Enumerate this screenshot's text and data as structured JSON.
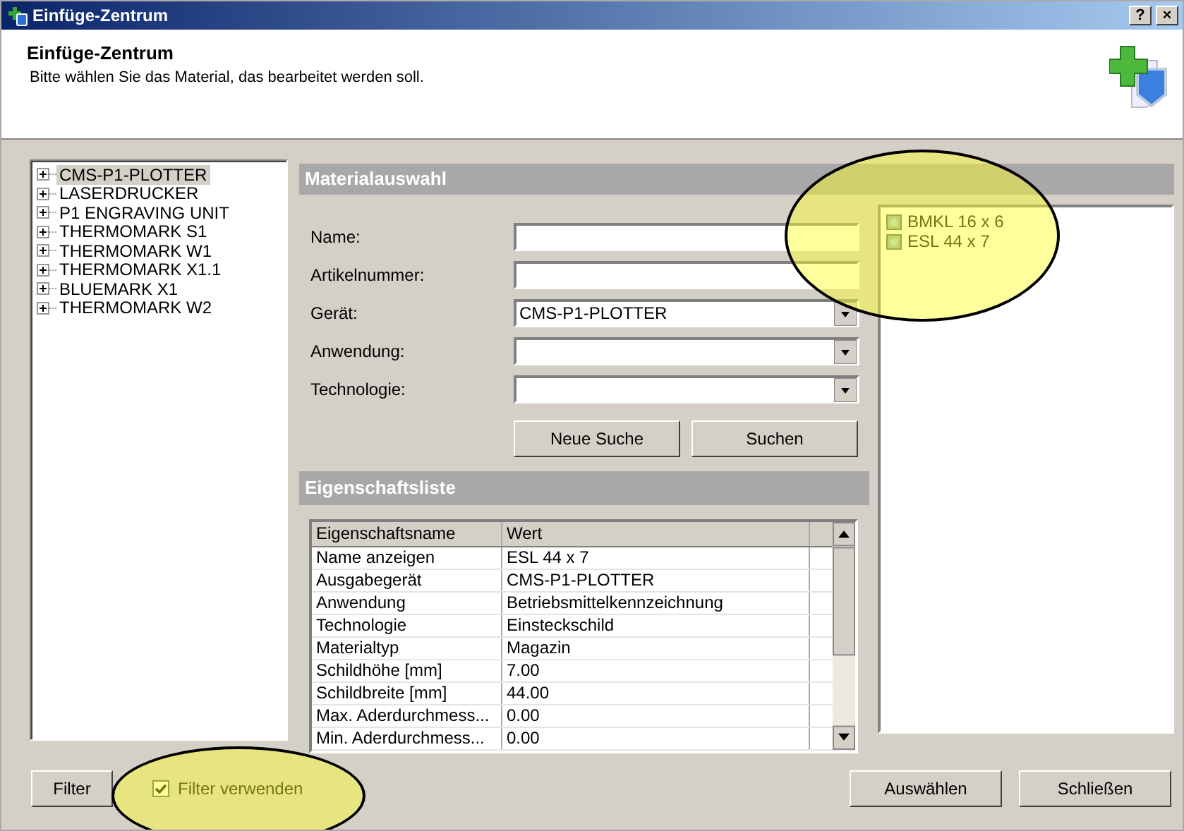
{
  "window": {
    "title": "Einfüge-Zentrum",
    "controls": [
      "?",
      "×"
    ]
  },
  "header": {
    "title": "Einfüge-Zentrum",
    "subtitle": "Bitte wählen Sie das Material, das bearbeitet werden soll."
  },
  "device_tree": [
    {
      "label": "CMS-P1-PLOTTER",
      "expanded": false,
      "selected": true
    },
    {
      "label": "LASERDRUCKER",
      "expanded": false,
      "selected": false
    },
    {
      "label": "P1 ENGRAVING UNIT",
      "expanded": false,
      "selected": false
    },
    {
      "label": "THERMOMARK S1",
      "expanded": false,
      "selected": false
    },
    {
      "label": "THERMOMARK W1",
      "expanded": false,
      "selected": false
    },
    {
      "label": "THERMOMARK X1.1",
      "expanded": false,
      "selected": false
    },
    {
      "label": "BLUEMARK X1",
      "expanded": false,
      "selected": false
    },
    {
      "label": "THERMOMARK W2",
      "expanded": false,
      "selected": false
    }
  ],
  "material_selection": {
    "title": "Materialauswahl",
    "fields": [
      {
        "label": "Name:",
        "kind": "text"
      },
      {
        "label": "Artikelnummer:",
        "kind": "text"
      },
      {
        "label": "Gerät:",
        "kind": "dropdown",
        "value": "CMS-P1-PLOTTER"
      },
      {
        "label": "Anwendung:",
        "kind": "dropdown"
      },
      {
        "label": "Technologie:",
        "kind": "dropdown"
      }
    ],
    "buttons": [
      "Neue Suche",
      "Suchen"
    ]
  },
  "results": [
    {
      "label": "BMKL 16 x 6"
    },
    {
      "label": "ESL 44 x 7"
    }
  ],
  "properties": {
    "title": "Eigenschaftsliste",
    "columns": [
      "Eigenschaftsname",
      "Wert"
    ],
    "rows": [
      [
        "Name anzeigen",
        "ESL 44 x 7"
      ],
      [
        "Ausgabegerät",
        "CMS-P1-PLOTTER"
      ],
      [
        "Anwendung",
        "Betriebsmittelkennzeichnung"
      ],
      [
        "Technologie",
        "Einsteckschild"
      ],
      [
        "Materialtyp",
        "Magazin"
      ],
      [
        "Schildhöhe [mm]",
        "7.00"
      ],
      [
        "Schildbreite [mm]",
        "44.00"
      ],
      [
        "Max. Aderdurchmess...",
        "0.00"
      ],
      [
        "Min. Aderdurchmess...",
        "0.00"
      ]
    ]
  },
  "footer": {
    "filter_button": "Filter",
    "use_filter": {
      "label": "Filter verwenden",
      "checked": true
    },
    "buttons": [
      "Auswählen",
      "Schließen"
    ]
  }
}
